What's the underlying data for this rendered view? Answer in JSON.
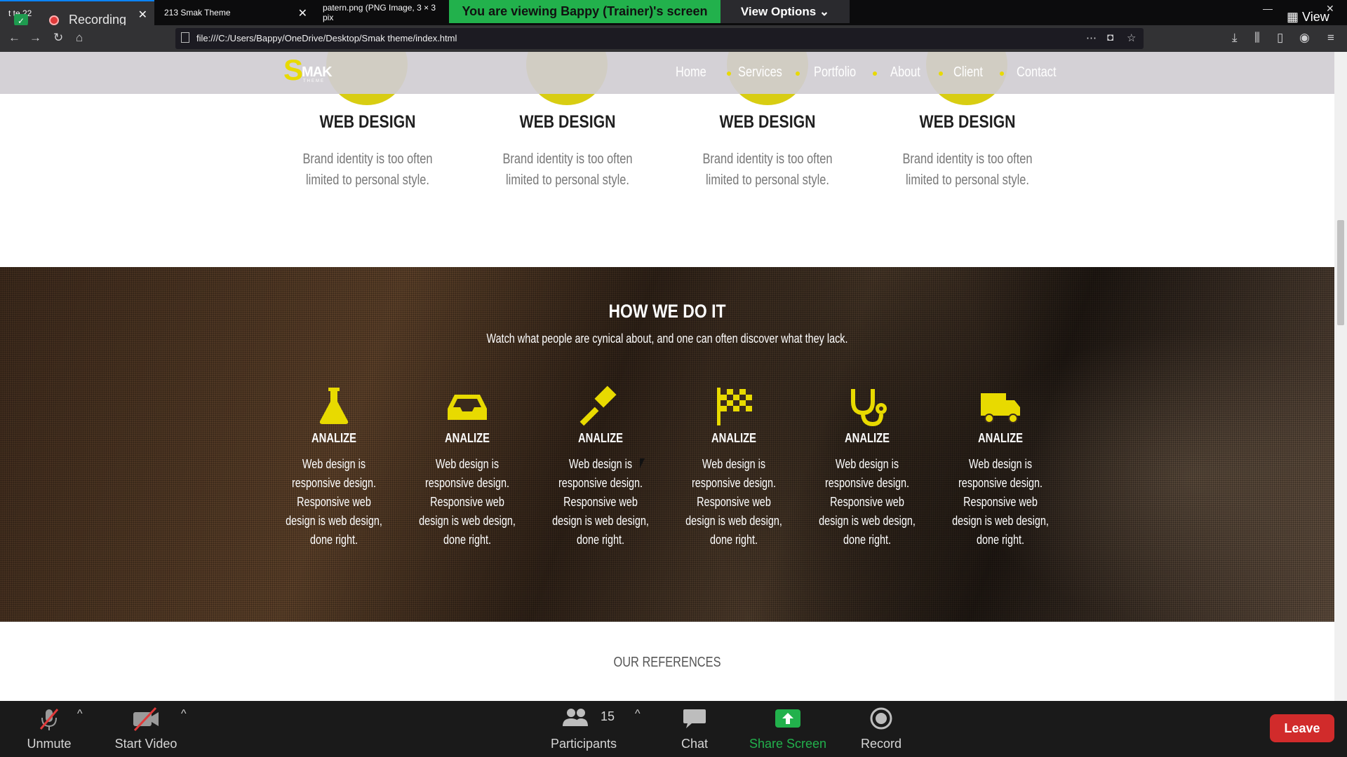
{
  "browser": {
    "tabs": [
      {
        "label": "t  te 22"
      },
      {
        "label": "213 Smak Theme"
      },
      {
        "label": "patern.png (PNG Image, 3 × 3 pix"
      }
    ],
    "recording_label": "Recording",
    "url": "file:///C:/Users/Bappy/OneDrive/Desktop/Smak theme/index.html"
  },
  "zoom_overlay": {
    "viewing_banner": "You are viewing Bappy (Trainer)'s screen",
    "view_options": "View Options ⌄",
    "view_label": "View"
  },
  "site": {
    "logo": {
      "letter": "S",
      "text": "MAK",
      "sub": "THEME"
    },
    "nav": [
      "Home",
      "Services",
      "Portfolio",
      "About",
      "Client",
      "Contact"
    ],
    "accent_color": "#d8cd12",
    "services": [
      {
        "title": "WEB DESIGN",
        "text": "Brand identity is too often limited to personal style."
      },
      {
        "title": "WEB DESIGN",
        "text": "Brand identity is too often limited to personal style."
      },
      {
        "title": "WEB DESIGN",
        "text": "Brand identity is too often limited to personal style."
      },
      {
        "title": "WEB DESIGN",
        "text": "Brand identity is too often limited to personal style."
      }
    ],
    "how": {
      "title": "HOW WE DO IT",
      "subtitle": "Watch what people are cynical about, and one can often discover what they lack.",
      "features": [
        {
          "icon": "flask-icon",
          "title": "ANALIZE",
          "text": "Web design is responsive design. Responsive web design is web design, done right."
        },
        {
          "icon": "inbox-icon",
          "title": "ANALIZE",
          "text": "Web design is responsive design. Responsive web design is web design, done right."
        },
        {
          "icon": "gavel-icon",
          "title": "ANALIZE",
          "text": "Web design is responsive design. Responsive web design is web design, done right."
        },
        {
          "icon": "flag-checkered-icon",
          "title": "ANALIZE",
          "text": "Web design is responsive design. Responsive web design is web design, done right."
        },
        {
          "icon": "stethoscope-icon",
          "title": "ANALIZE",
          "text": "Web design is responsive design. Responsive web design is web design, done right."
        },
        {
          "icon": "truck-icon",
          "title": "ANALIZE",
          "text": "Web design is responsive design. Responsive web design is web design, done right."
        }
      ]
    },
    "references_title": "OUR REFERENCES"
  },
  "zoom_toolbar": {
    "unmute": "Unmute",
    "start_video": "Start Video",
    "participants": "Participants",
    "participants_count": "15",
    "chat": "Chat",
    "share_screen": "Share Screen",
    "record": "Record",
    "leave": "Leave"
  }
}
